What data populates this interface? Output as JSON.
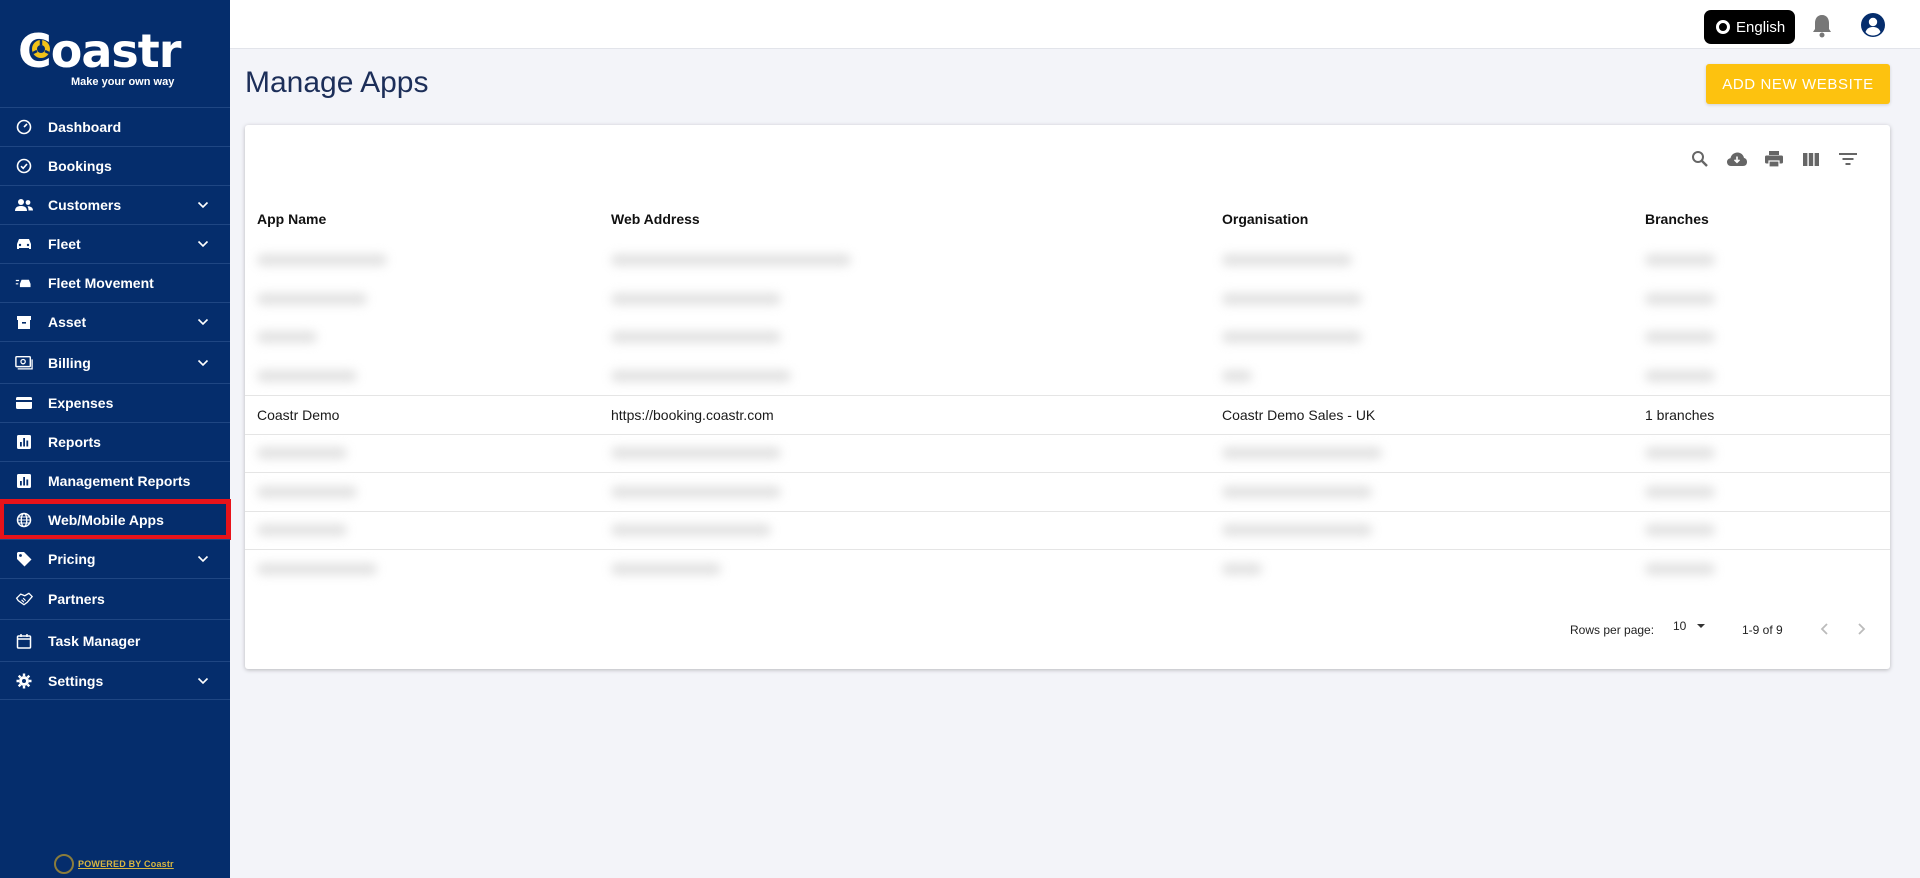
{
  "brand": {
    "name": "Coastr",
    "tagline": "Make your own way",
    "powered_by": "POWERED BY Coastr",
    "colors": {
      "sidebar": "#052d6c",
      "accent": "#fdc20f",
      "highlight": "#e8131a"
    }
  },
  "sidebar": {
    "items": [
      {
        "label": "Dashboard",
        "icon": "speedometer-icon",
        "expandable": false
      },
      {
        "label": "Bookings",
        "icon": "check-circle-icon",
        "expandable": false
      },
      {
        "label": "Customers",
        "icon": "people-icon",
        "expandable": true
      },
      {
        "label": "Fleet",
        "icon": "car-icon",
        "expandable": true
      },
      {
        "label": "Fleet Movement",
        "icon": "car-transfer-icon",
        "expandable": false
      },
      {
        "label": "Asset",
        "icon": "archive-icon",
        "expandable": true
      },
      {
        "label": "Billing",
        "icon": "billing-icon",
        "expandable": true
      },
      {
        "label": "Expenses",
        "icon": "credit-card-icon",
        "expandable": false
      },
      {
        "label": "Reports",
        "icon": "bar-chart-icon",
        "expandable": false
      },
      {
        "label": "Management Reports",
        "icon": "bar-chart-icon",
        "expandable": false
      },
      {
        "label": "Web/Mobile Apps",
        "icon": "globe-icon",
        "expandable": false,
        "active": true
      },
      {
        "label": "Pricing",
        "icon": "tag-icon",
        "expandable": true
      },
      {
        "label": "Partners",
        "icon": "handshake-icon",
        "expandable": false
      },
      {
        "label": "Task Manager",
        "icon": "calendar-icon",
        "expandable": false
      },
      {
        "label": "Settings",
        "icon": "gear-icon",
        "expandable": true
      }
    ]
  },
  "topbar": {
    "language": "English"
  },
  "page": {
    "title": "Manage Apps",
    "add_button": "ADD NEW WEBSITE"
  },
  "table": {
    "columns": [
      "App Name",
      "Web Address",
      "Organisation",
      "Branches"
    ],
    "visible_row": {
      "app_name": "Coastr Demo",
      "web_address": "https://booking.coastr.com",
      "organisation": "Coastr Demo Sales - UK",
      "branches": "1 branches"
    },
    "rows_per_page_label": "Rows per page:",
    "rows_per_page": "10",
    "range": "1-9 of 9"
  }
}
